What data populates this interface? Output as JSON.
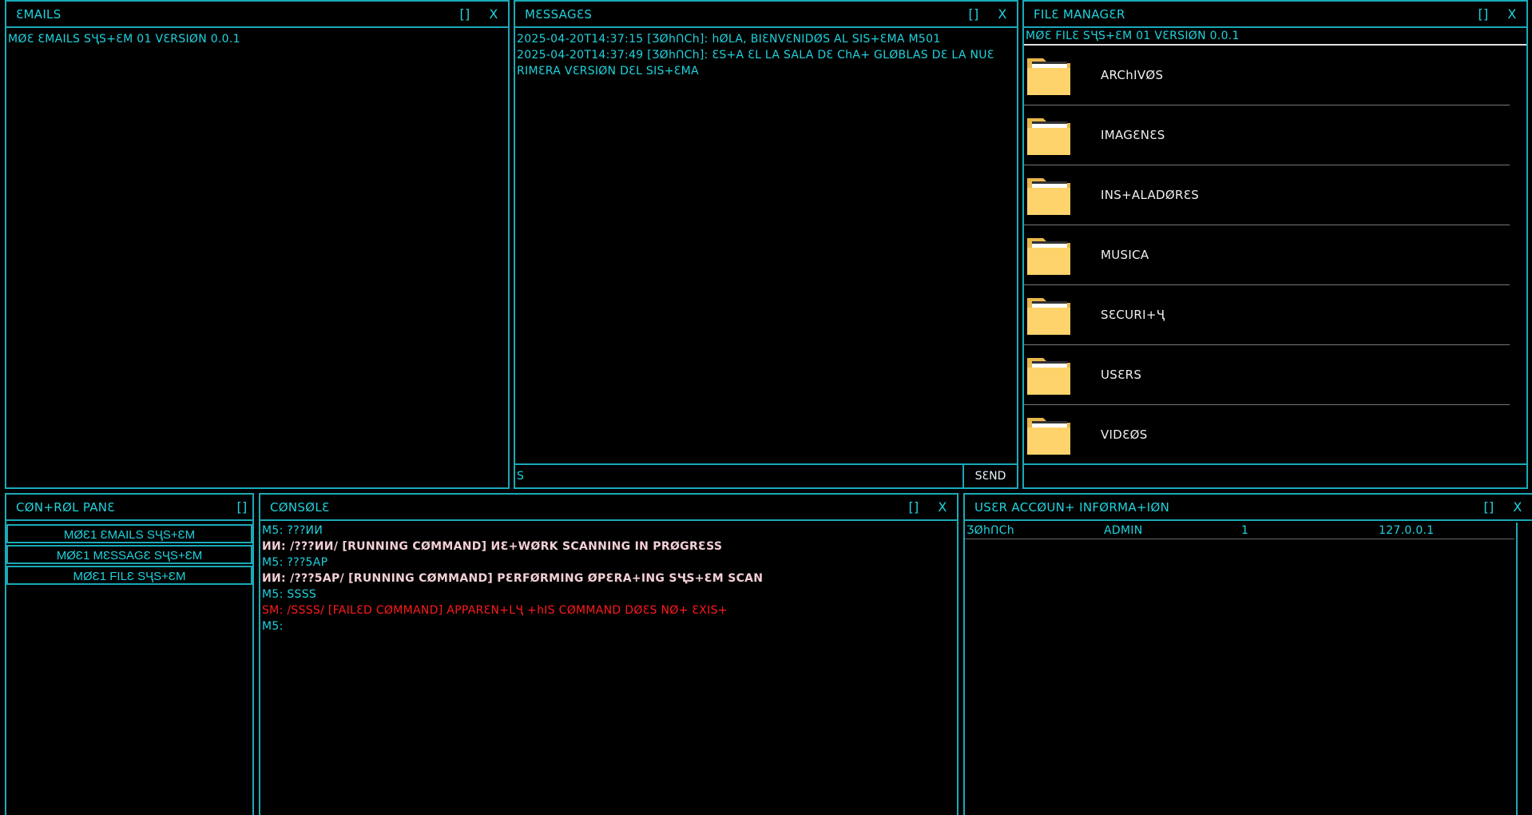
{
  "emails": {
    "title": "ƐMAILS",
    "maximize": "[]",
    "close": "X",
    "lines": [
      "MØƐ ƐMAILS SҶS+ƐM 01 VƐRSIØN 0.0.1"
    ]
  },
  "messages": {
    "title": "MƐSSAGƐS",
    "maximize": "[]",
    "close": "X",
    "lines": [
      "2025-04-20T14:37:15 [ƷØhՈCh]: hØLA, BIƐNVƐNIDØS AL SIS+ƐMA M501",
      "2025-04-20T14:37:49 [ƷØhՈCh]: ƐS+A ƐL LA SALA DƐ ChA+ GLØBLAS DƐ LA NUƐ",
      "RIMƐRA VƐRSIØN DƐL SIS+ƐMA"
    ],
    "input_value": "S",
    "send_label": "SƐND"
  },
  "file_manager": {
    "title": "FILƐ MANAGƐR",
    "maximize": "[]",
    "close": "X",
    "header": "MØƐ FILƐ SҶS+ƐM 01 VƐRSIØN 0.0.1",
    "folder_color": "#ffd36b",
    "folders": [
      {
        "label": "ARChIVØS"
      },
      {
        "label": "IMAGƐNƐS"
      },
      {
        "label": "INS+ALADØRƐS"
      },
      {
        "label": "MUSICA"
      },
      {
        "label": "SƐCURI+Ҷ"
      },
      {
        "label": "USƐRS"
      },
      {
        "label": "VIDƐØS"
      }
    ]
  },
  "control_pane": {
    "title": "CØN+RØL PANƐ",
    "maximize": "[]",
    "buttons": [
      {
        "label": "MØƐ1 ƐMAILS SҶS+ƐM"
      },
      {
        "label": "MØƐ1 MƐSSAGƐ SҶS+ƐM"
      },
      {
        "label": "MØƐ1 FILƐ SҶS+ƐM"
      }
    ]
  },
  "console": {
    "title": "CØNSØLƐ",
    "maximize": "[]",
    "close": "X",
    "lines": [
      {
        "text": "M5: ???ИИ",
        "kind": "input"
      },
      {
        "text": "ИИ: /???ИИ/ [RUNNING CØMMAND] ИƐ+WØRK SCANNING IN PRØGRƐSS",
        "kind": "output"
      },
      {
        "text": "M5: ???5AP",
        "kind": "input"
      },
      {
        "text": "ИИ: /???5AP/ [RUNNING CØMMAND] PƐRFØRMING ØPƐRA+ING SҶS+ƐM SCAN",
        "kind": "output"
      },
      {
        "text": "M5: SSSS",
        "kind": "input"
      },
      {
        "text": "SM: /SSSS/ [FAILƐD CØMMAND] APPARƐN+LҶ +hIS CØMMAND DØƐS NØ+ ƐXIS+",
        "kind": "error"
      },
      {
        "text": "M5:",
        "kind": "input"
      }
    ]
  },
  "user_account": {
    "title": "USƐR ACCØUN+ INFØRMA+IØN",
    "maximize": "[]",
    "close": "X",
    "rows": [
      {
        "user": "ƷØhՈCh",
        "role": "ADMIN",
        "id": "1",
        "ip": "127.0.0.1"
      }
    ]
  },
  "colors": {
    "accent": "#1fd3de",
    "border": "#1aa9b8",
    "error": "#ff1a1a",
    "output": "#f3d0d6",
    "background": "#000000"
  }
}
